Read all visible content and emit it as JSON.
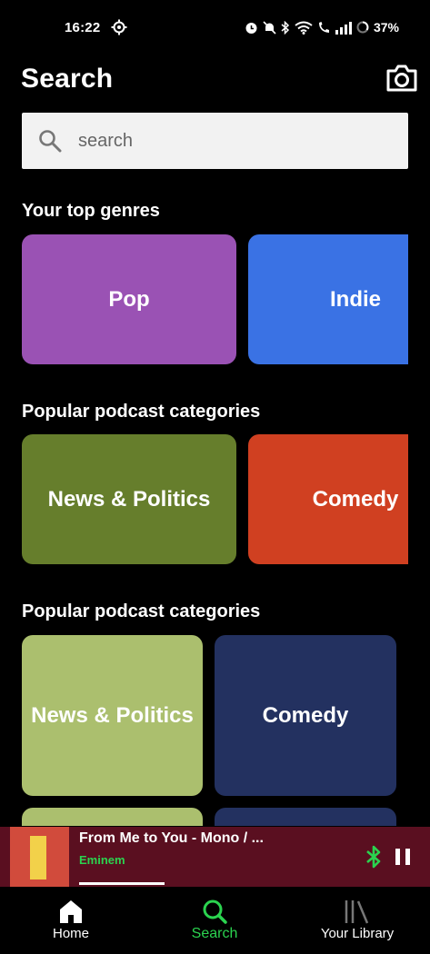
{
  "status_bar": {
    "time": "16:22",
    "battery": "37%"
  },
  "header": {
    "title": "Search"
  },
  "search": {
    "placeholder": "search"
  },
  "sections": [
    {
      "title": "Your top genres",
      "tiles": [
        {
          "label": "Pop",
          "color": "#9a52b4"
        },
        {
          "label": "Indie",
          "color": "#3a72e4"
        }
      ]
    },
    {
      "title": "Popular podcast categories",
      "tiles": [
        {
          "label": "News & Politics",
          "color": "#667e2c"
        },
        {
          "label": "Comedy",
          "color": "#d04021"
        }
      ]
    },
    {
      "title": "Popular podcast categories",
      "tiles": [
        {
          "label": "News & Politics",
          "color": "#abbf6e"
        },
        {
          "label": "Comedy",
          "color": "#233160"
        }
      ]
    }
  ],
  "now_playing": {
    "title": "From Me to You - Mono / ...",
    "artist": "Eminem",
    "progress": 0.26
  },
  "bottom_nav": [
    {
      "label": "Home",
      "icon": "home-icon",
      "active": false
    },
    {
      "label": "Search",
      "icon": "search-icon",
      "active": true
    },
    {
      "label": "Your Library",
      "icon": "library-icon",
      "active": false
    }
  ],
  "colors": {
    "accent": "#2bd34f",
    "background": "#000000",
    "player_bg": "#5a0f20"
  }
}
